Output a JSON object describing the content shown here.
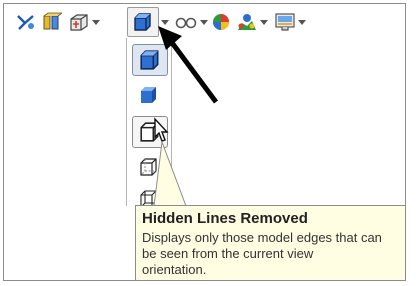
{
  "toolbar": {
    "icons": [
      "view-orientation-icon",
      "section-view-icon",
      "standard-views-icon",
      "display-style-icon",
      "hide-show-items-icon",
      "edit-appearance-icon",
      "apply-scene-icon",
      "view-settings-icon"
    ]
  },
  "display_style_menu": {
    "items": [
      {
        "icon": "shaded-with-edges-icon",
        "state": "selected"
      },
      {
        "icon": "shaded-icon",
        "state": "normal"
      },
      {
        "icon": "hidden-lines-removed-icon",
        "state": "hover"
      },
      {
        "icon": "hidden-lines-visible-icon",
        "state": "normal"
      },
      {
        "icon": "wireframe-icon",
        "state": "normal"
      }
    ]
  },
  "tooltip": {
    "title": "Hidden Lines Removed",
    "lines": [
      "Displays only those model edges that can",
      "be seen from the current view",
      "orientation."
    ]
  },
  "colors": {
    "tooltip_bg": "#fffde2",
    "menu_highlight": "#dfe6ef",
    "cube_blue": "#2f6fcf"
  }
}
